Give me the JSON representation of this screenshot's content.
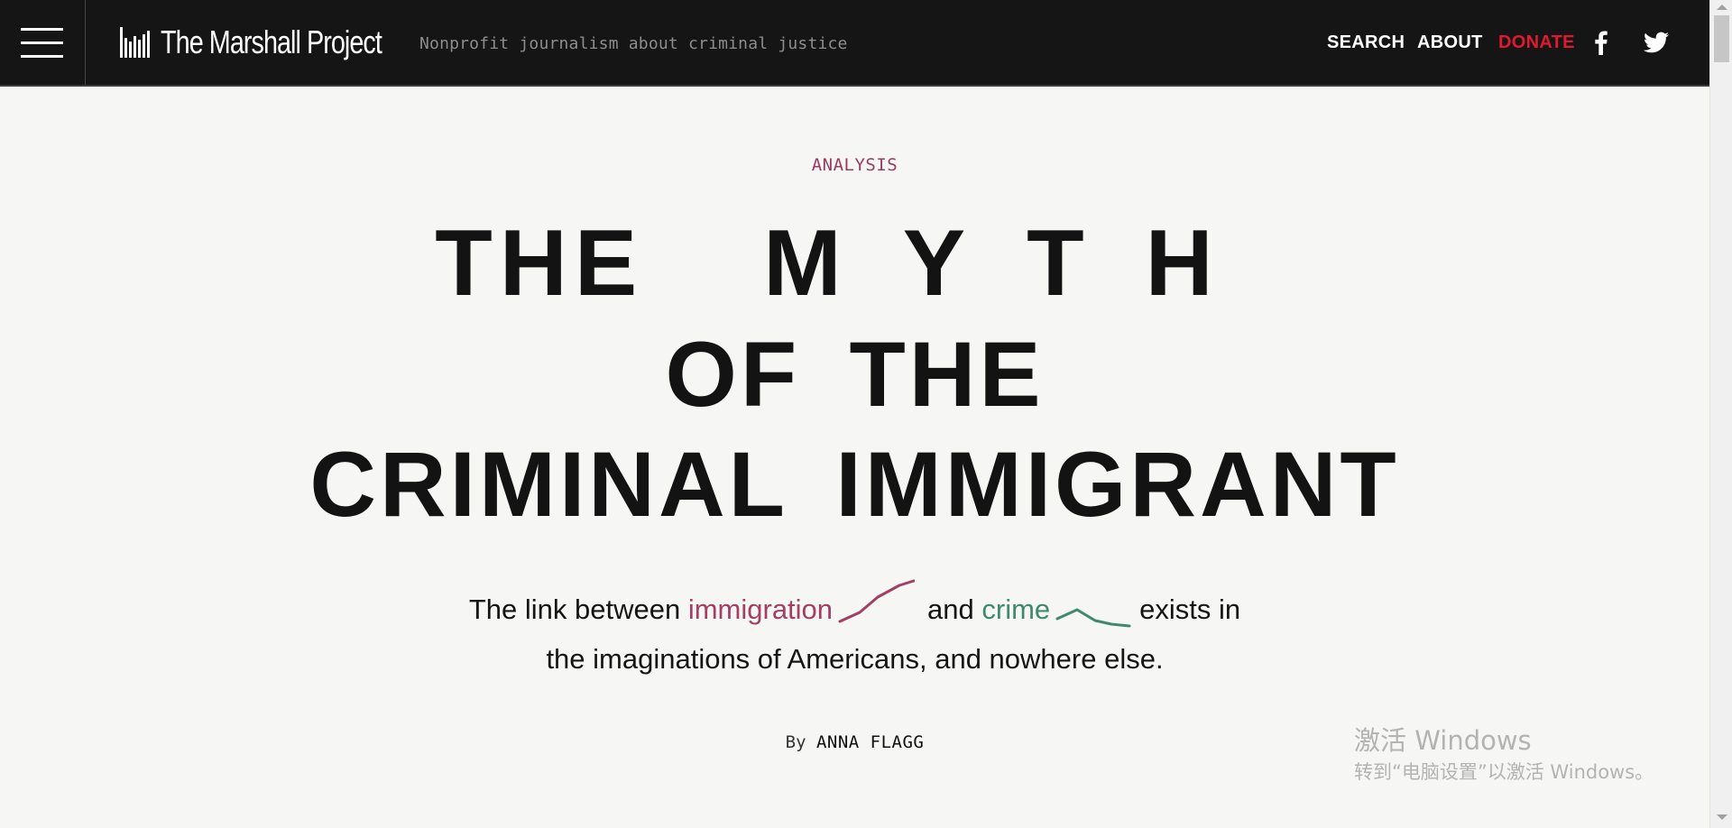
{
  "header": {
    "site_name": "The Marshall Project",
    "tagline": "Nonprofit journalism about criminal justice",
    "nav": {
      "search": "SEARCH",
      "about": "ABOUT",
      "donate": "DONATE"
    },
    "social": [
      "facebook-icon",
      "twitter-icon"
    ]
  },
  "article": {
    "kicker": "ANALYSIS",
    "headline": {
      "line1_the": "THE",
      "line1_myth": "MYTH",
      "line2": "OF THE",
      "line3": "CRIMINAL IMMIGRANT"
    },
    "dek": {
      "part1": "The link between ",
      "immigration": "immigration",
      "part2": "and ",
      "crime": "crime",
      "part3": "exists in",
      "line2": "the imaginations of Americans, and nowhere else."
    },
    "byline": {
      "prefix": "By",
      "author": "ANNA FLAGG"
    }
  },
  "os_watermark": {
    "title": "激活 Windows",
    "subtitle": "转到“电脑设置”以激活 Windows。"
  },
  "colors": {
    "topbar": "#151515",
    "background": "#f6f6f4",
    "donate": "#e1192e",
    "immigration": "#a33e65",
    "crime": "#3f8a6e"
  }
}
